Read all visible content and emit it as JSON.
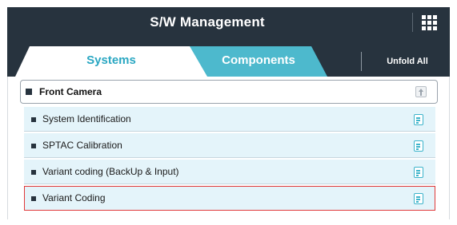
{
  "header": {
    "title": "S/W Management",
    "menu_icon": "grid-icon"
  },
  "tabs": [
    {
      "label": "Systems",
      "active": true
    },
    {
      "label": "Components",
      "active": false
    }
  ],
  "unfold_label": "Unfold All",
  "group": {
    "label": "Front Camera",
    "fold_icon": "collapse-icon",
    "items": [
      {
        "label": "System Identification",
        "icon": "document-icon",
        "selected": false
      },
      {
        "label": "SPTAC Calibration",
        "icon": "document-icon",
        "selected": false
      },
      {
        "label": "Variant coding (BackUp & Input)",
        "icon": "document-icon",
        "selected": false
      },
      {
        "label": "Variant Coding",
        "icon": "document-icon",
        "selected": true
      }
    ]
  },
  "colors": {
    "header_bg": "#27333e",
    "accent": "#2aa7c2",
    "inactive_tab": "#4db9cd",
    "item_bg": "#e4f4fa",
    "selection": "#e0393a"
  }
}
